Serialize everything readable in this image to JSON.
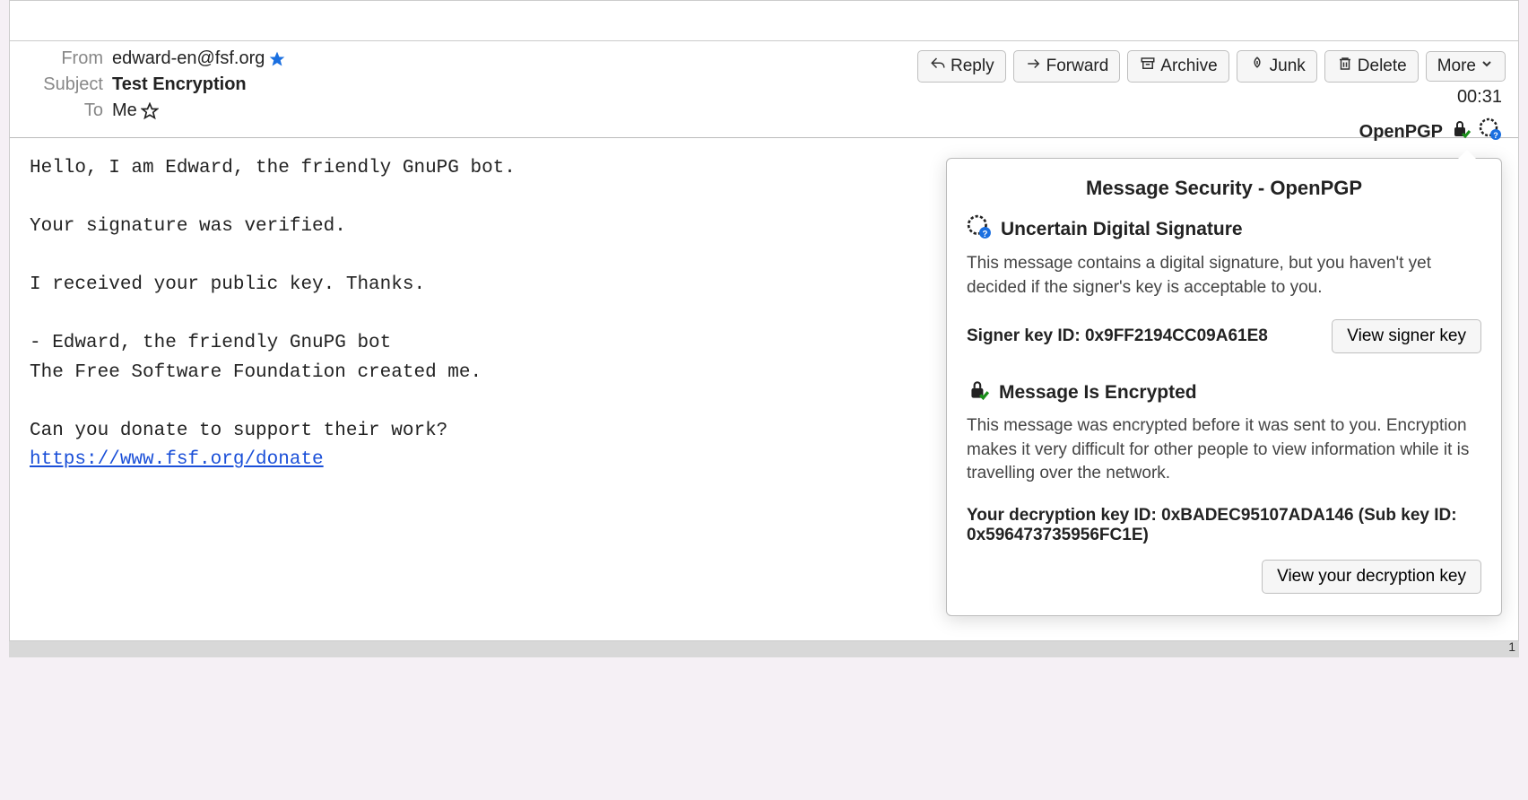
{
  "header": {
    "from_label": "From",
    "from_value": "edward-en@fsf.org",
    "subject_label": "Subject",
    "subject_value": "Test Encryption",
    "to_label": "To",
    "to_value": "Me",
    "time": "00:31",
    "openpgp_label": "OpenPGP"
  },
  "actions": {
    "reply": "Reply",
    "forward": "Forward",
    "archive": "Archive",
    "junk": "Junk",
    "delete": "Delete",
    "more": "More"
  },
  "body": {
    "line1": "Hello, I am Edward, the friendly GnuPG bot.",
    "line2": "Your signature was verified.",
    "line3": "I received your public key. Thanks.",
    "line4": "- Edward, the friendly GnuPG bot",
    "line5": "The Free Software Foundation created me.",
    "line6": "Can you donate to support their work?",
    "link_text": "https://www.fsf.org/donate"
  },
  "popup": {
    "title": "Message Security - OpenPGP",
    "sig_heading": "Uncertain Digital Signature",
    "sig_text": "This message contains a digital signature, but you haven't yet decided if the signer's key is acceptable to you.",
    "signer_key_label": "Signer key ID: 0x9FF2194CC09A61E8",
    "view_signer_btn": "View signer key",
    "enc_heading": "Message Is Encrypted",
    "enc_text": "This message was encrypted before it was sent to you. Encryption makes it very difficult for other people to view information while it is travelling over the network.",
    "decryption_key_label": "Your decryption key ID: 0xBADEC95107ADA146 (Sub key ID: 0x596473735956FC1E)",
    "view_decryption_btn": "View your decryption key"
  }
}
